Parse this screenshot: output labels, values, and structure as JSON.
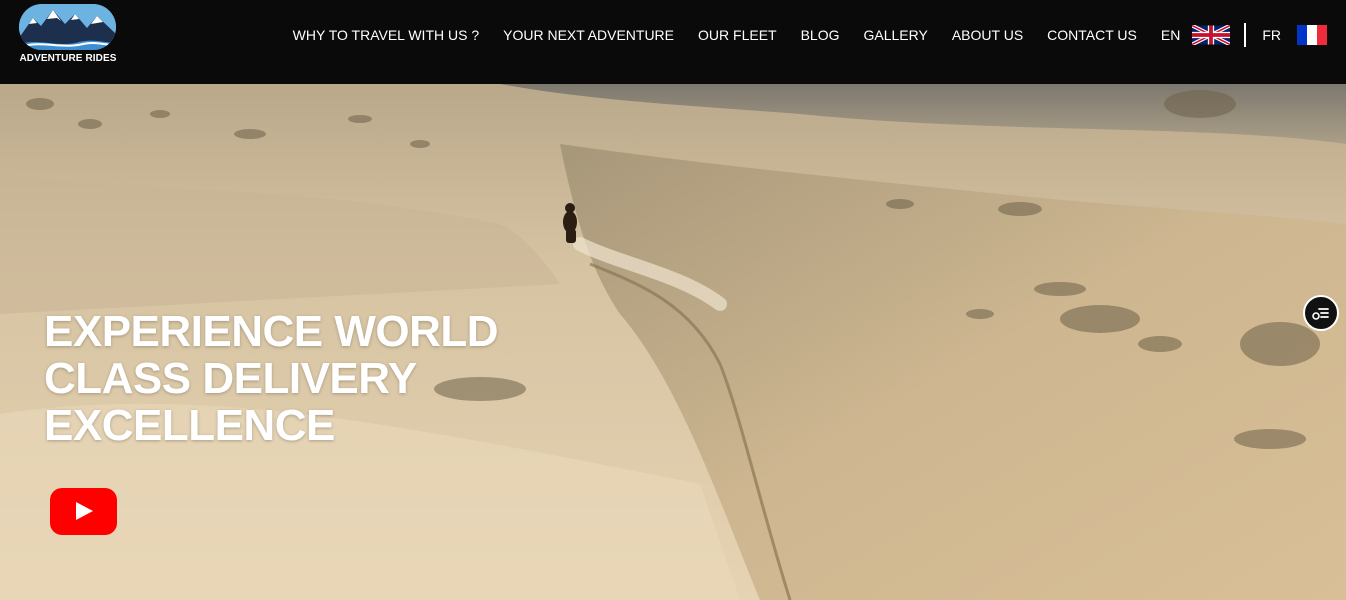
{
  "brand": {
    "name": "ADVENTURE RIDES",
    "logo_icon": "mountain-logo-icon"
  },
  "nav": {
    "items": [
      {
        "label": "WHY TO TRAVEL WITH US ?"
      },
      {
        "label": "YOUR NEXT ADVENTURE"
      },
      {
        "label": "OUR FLEET"
      },
      {
        "label": "BLOG"
      },
      {
        "label": "GALLERY"
      },
      {
        "label": "ABOUT US"
      },
      {
        "label": "CONTACT US"
      }
    ],
    "languages": [
      {
        "code": "EN",
        "flag": "uk-flag-icon"
      },
      {
        "code": "FR",
        "flag": "france-flag-icon"
      }
    ]
  },
  "hero": {
    "headline_lines": [
      "EXPERIENCE WORLD",
      "CLASS DELIVERY",
      "EXCELLENCE"
    ],
    "play_icon": "youtube-play-icon",
    "widget_icon": "accessibility-menu-icon"
  },
  "colors": {
    "header_bg": "#0a0a0a",
    "youtube_red": "#ff0000",
    "sand": "#d9c3a0",
    "text": "#ffffff"
  }
}
